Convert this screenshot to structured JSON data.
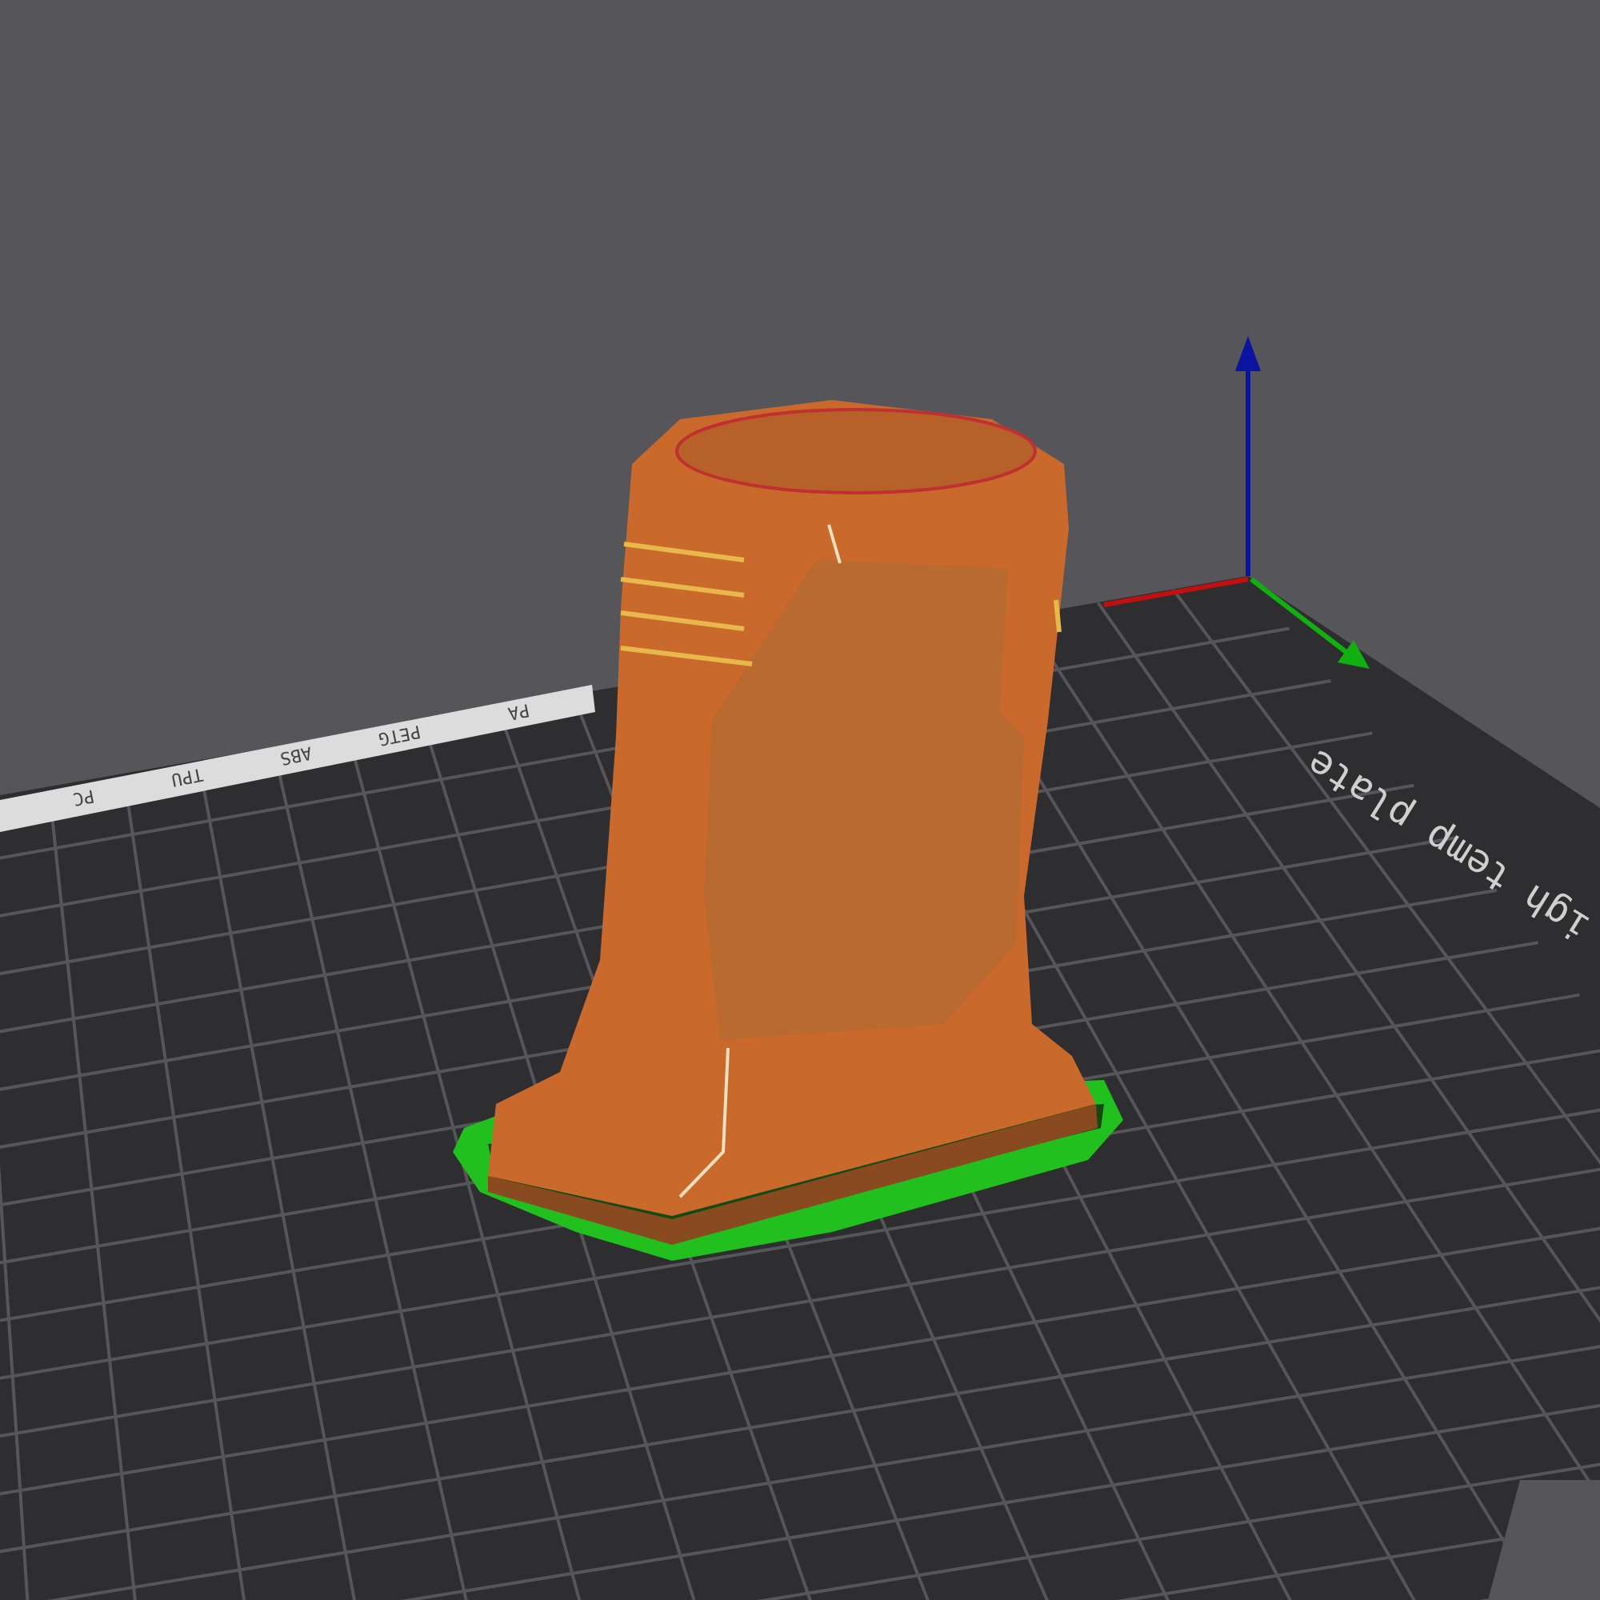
{
  "viewport": {
    "bed": {
      "strip_texts": [
        "PA",
        "PETG",
        "ABS",
        "TPU",
        "PC"
      ],
      "label": "igh temp plate"
    }
  }
}
